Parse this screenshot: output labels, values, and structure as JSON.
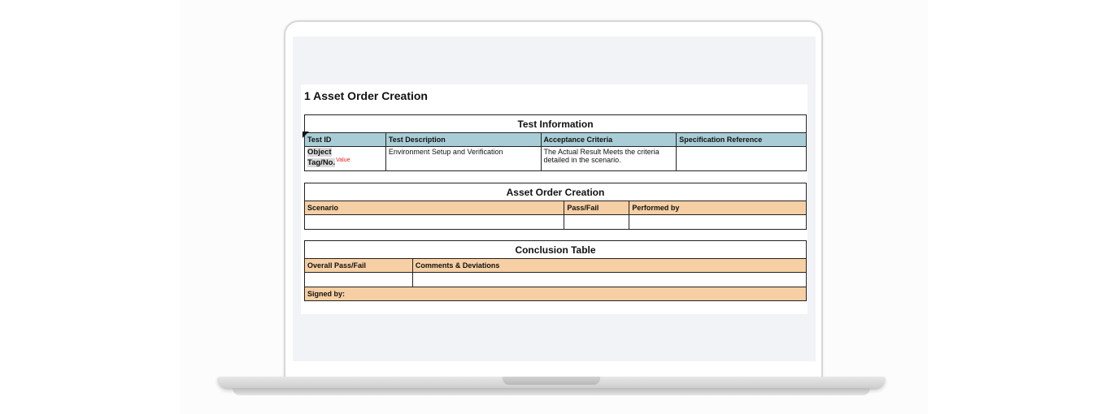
{
  "document": {
    "title": "1 Asset Order Creation",
    "test_information": {
      "caption": "Test Information",
      "headers": [
        "Test ID",
        "Test Description",
        "Acceptance Criteria",
        "Specification Reference"
      ],
      "row": {
        "test_id_line1": "Object",
        "test_id_line2": "Tag/No.",
        "test_id_value": "Value",
        "description": "Environment Setup and Verification",
        "acceptance_line1": "The Actual Result Meets the criteria",
        "acceptance_line2": "detailed in the scenario.",
        "specification_reference": ""
      }
    },
    "asset_order_creation": {
      "caption": "Asset Order Creation",
      "headers": [
        "Scenario",
        "Pass/Fail",
        "Performed by"
      ]
    },
    "conclusion": {
      "caption": "Conclusion Table",
      "headers": [
        "Overall Pass/Fail",
        "Comments & Deviations"
      ],
      "signed_by": "Signed by:"
    }
  },
  "colors": {
    "header_blue": "#a9cdd6",
    "header_tan": "#f6cfa4",
    "value_red": "#e0231b"
  }
}
